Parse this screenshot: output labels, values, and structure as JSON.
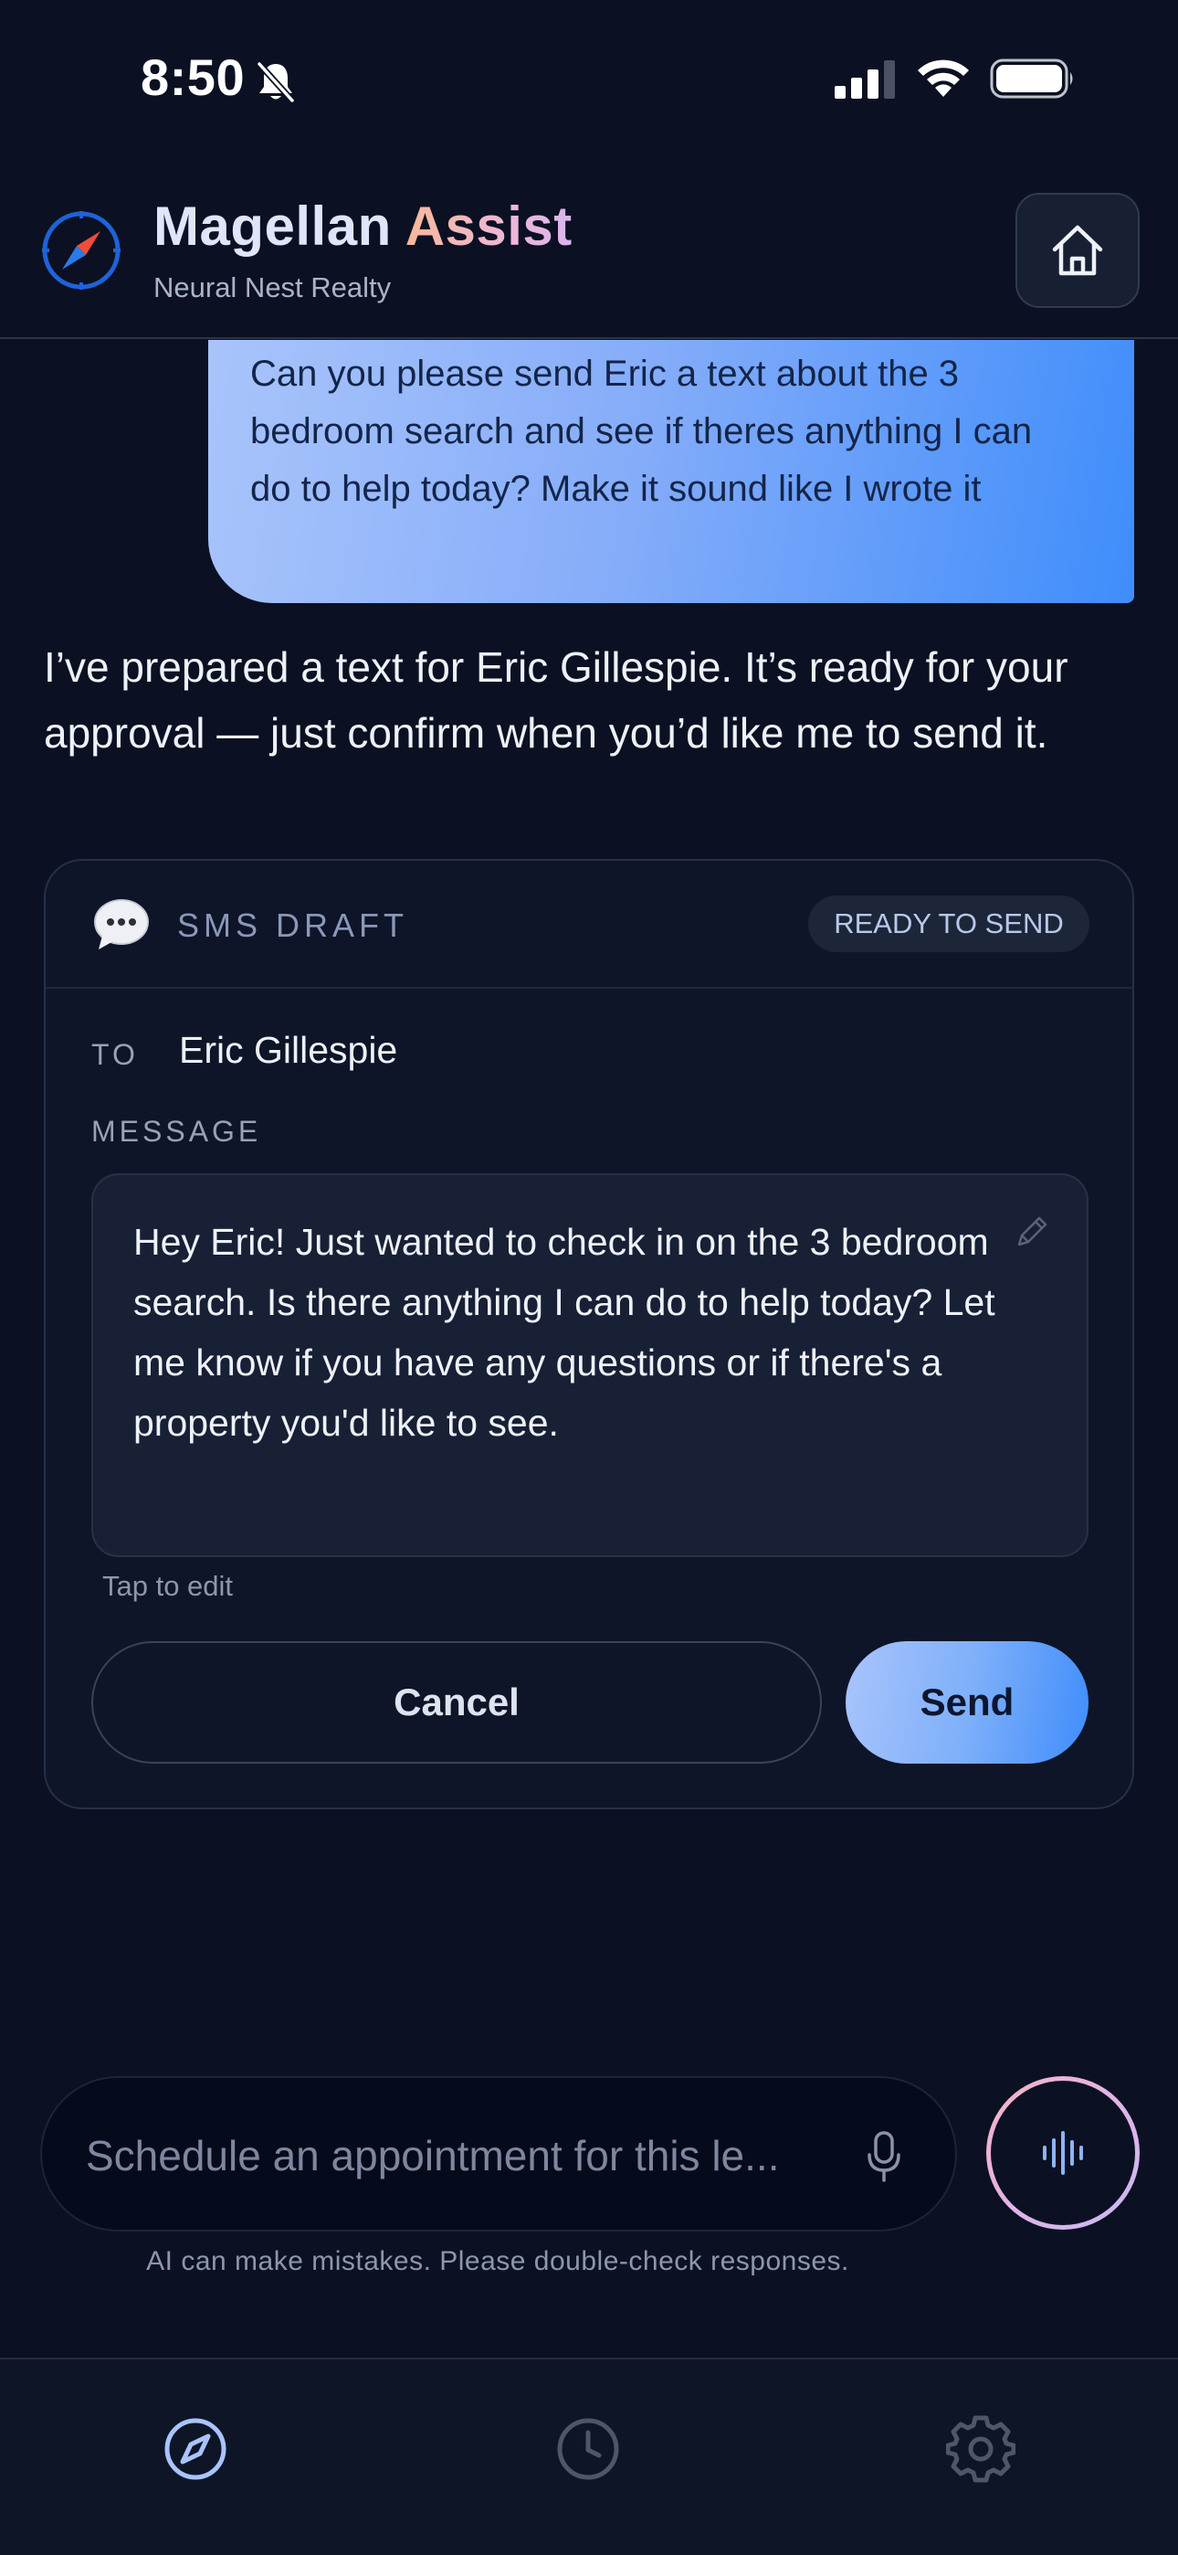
{
  "status_bar": {
    "time": "8:50"
  },
  "header": {
    "brand_main": "Magellan",
    "brand_accent": "Assist",
    "subtitle": "Neural Nest Realty",
    "icons": {
      "logo": "compass-logo",
      "home": "home-icon"
    }
  },
  "chat": {
    "user_message": "Can you please send Eric a text about the 3 bedroom search and see if theres anything I can do to help today? Make it sound like I wrote it",
    "assistant_message": "I’ve prepared a text for Eric Gillespie. It’s ready for your approval — just confirm when you’d like me to send it."
  },
  "sms_card": {
    "kind_label": "SMS DRAFT",
    "status_badge": "READY TO SEND",
    "to_label": "TO",
    "recipient": "Eric Gillespie",
    "message_label": "MESSAGE",
    "message_body": "Hey Eric! Just wanted to check in on the 3 bedroom search. Is there anything I can do to help today? Let me know if you have any questions or if there's a property you'd like to see.",
    "edit_hint": "Tap to edit",
    "cancel_label": "Cancel",
    "send_label": "Send"
  },
  "composer": {
    "placeholder": "Schedule an appointment for this le...",
    "disclaimer": "AI can make mistakes. Please double-check responses."
  },
  "tab_bar": {
    "tabs": [
      {
        "icon": "compass-icon",
        "active": true
      },
      {
        "icon": "clock-icon",
        "active": false
      },
      {
        "icon": "gear-icon",
        "active": false
      }
    ]
  },
  "colors": {
    "background": "#0b1122",
    "accent_blue": "#3f8dfb",
    "accent_light_blue": "#a9c4fb",
    "brand_accent_start": "#f7b89a",
    "brand_accent_end": "#d9b5ee"
  }
}
